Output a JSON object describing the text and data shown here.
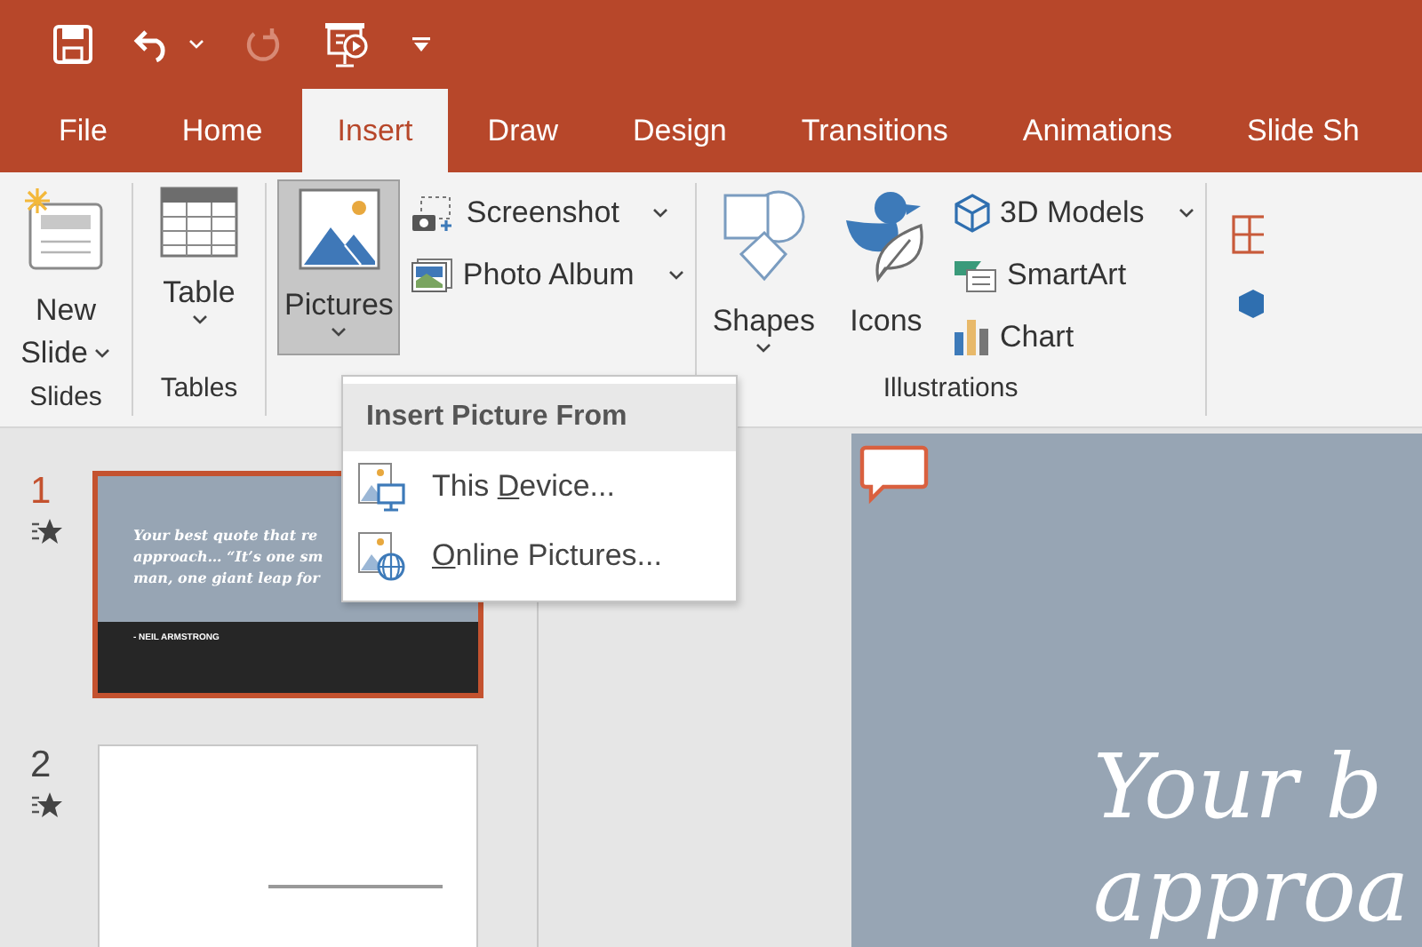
{
  "quick_access": [
    {
      "kind": "save"
    },
    {
      "kind": "undo",
      "dropdown": true
    },
    {
      "kind": "redo",
      "disabled": true
    },
    {
      "kind": "present"
    },
    {
      "kind": "customize"
    }
  ],
  "tabs": [
    {
      "label": "File",
      "selected": false
    },
    {
      "label": "Home",
      "selected": false
    },
    {
      "label": "Insert",
      "selected": true
    },
    {
      "label": "Draw",
      "selected": false
    },
    {
      "label": "Design",
      "selected": false
    },
    {
      "label": "Transitions",
      "selected": false
    },
    {
      "label": "Animations",
      "selected": false
    },
    {
      "label": "Slide Sh",
      "selected": false
    }
  ],
  "ribbon": {
    "groups": [
      {
        "label": "Slides",
        "large": [
          {
            "kind": "new_slide",
            "label_lines": [
              "New",
              "Slide"
            ],
            "dropdown": true
          }
        ]
      },
      {
        "label": "Tables",
        "large": [
          {
            "kind": "table",
            "label_lines": [
              "Table"
            ],
            "dropdown": true
          }
        ]
      },
      {
        "large": [
          {
            "kind": "pictures",
            "label_lines": [
              "Pictures"
            ],
            "dropdown": true,
            "pressed": true
          }
        ],
        "small": [
          {
            "kind": "screenshot",
            "label": "Screenshot",
            "dropdown": true
          },
          {
            "kind": "photo_album",
            "label": "Photo Album",
            "dropdown": true
          }
        ]
      },
      {
        "label": "Illustrations",
        "large": [
          {
            "kind": "shapes",
            "label_lines": [
              "Shapes"
            ],
            "dropdown": true
          },
          {
            "kind": "icons",
            "label_lines": [
              "Icons"
            ],
            "dropdown": false
          }
        ],
        "small": [
          {
            "kind": "models_3d",
            "label": "3D Models",
            "dropdown": true
          },
          {
            "kind": "smartart",
            "label": "SmartArt",
            "dropdown": false
          },
          {
            "kind": "chart",
            "label": "Chart",
            "dropdown": false
          }
        ]
      }
    ]
  },
  "picture_menu": {
    "header": "Insert Picture From",
    "items": [
      {
        "kind": "device",
        "before": "This ",
        "key": "D",
        "after": "evice..."
      },
      {
        "kind": "online",
        "key": "O",
        "after": "nline Pictures..."
      }
    ]
  },
  "slides": [
    {
      "number": "1",
      "selected": true,
      "animated": true,
      "thumb": {
        "kind": "quote",
        "lines": [
          "Your best quote that re",
          "approach… “It’s one sm",
          "man, one giant leap for"
        ],
        "attribution": "- NEIL ARMSTRONG"
      }
    },
    {
      "number": "2",
      "selected": false,
      "animated": true,
      "thumb": {
        "kind": "rule"
      }
    }
  ],
  "slide": {
    "comment": true,
    "title_lines": [
      "Your b",
      "approa"
    ]
  }
}
